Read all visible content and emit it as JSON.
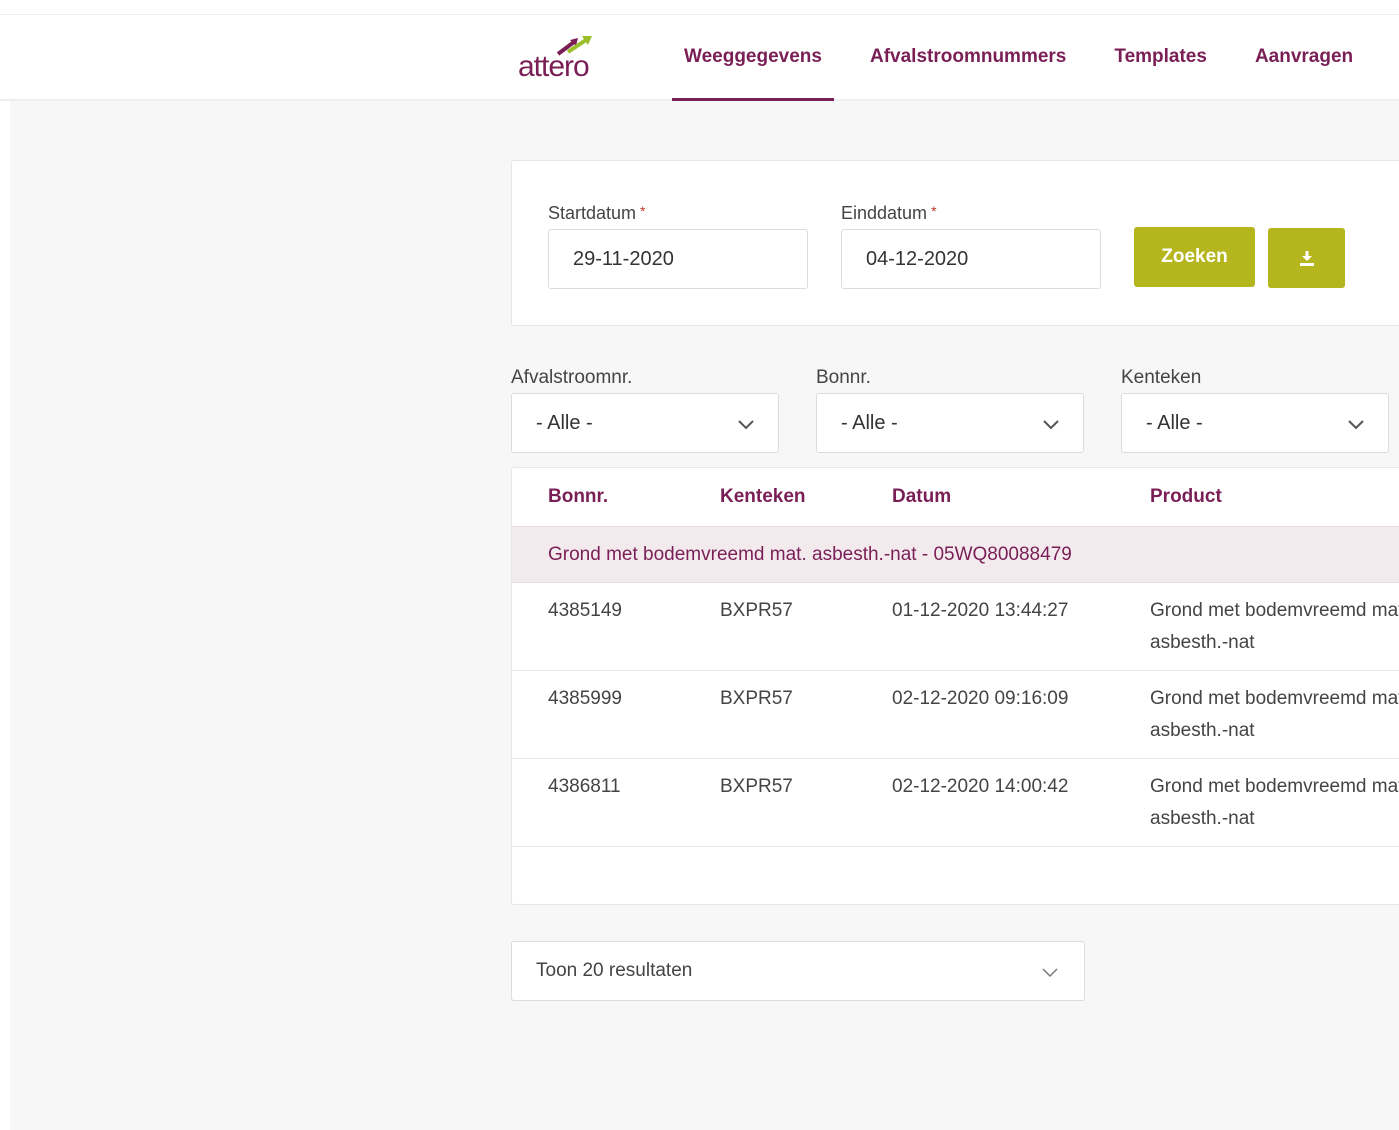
{
  "brand": {
    "logo_text": "attero",
    "accent_color": "#7a1f56",
    "button_color": "#b5b51e"
  },
  "nav": {
    "items": [
      {
        "label": "Weeggegevens",
        "active": true
      },
      {
        "label": "Afvalstroomnummers",
        "active": false
      },
      {
        "label": "Templates",
        "active": false
      },
      {
        "label": "Aanvragen",
        "active": false
      }
    ]
  },
  "dates": {
    "start_label": "Startdatum",
    "start_value": "29-11-2020",
    "end_label": "Einddatum",
    "end_value": "04-12-2020",
    "required_marker": "*",
    "search_button": "Zoeken",
    "download_icon": "download-icon"
  },
  "filters": {
    "afvalstroomnr": {
      "label": "Afvalstroomnr.",
      "value": "- Alle -"
    },
    "bonnr": {
      "label": "Bonnr.",
      "value": "- Alle -"
    },
    "kenteken": {
      "label": "Kenteken",
      "value": "- Alle -"
    }
  },
  "table": {
    "headers": {
      "bonnr": "Bonnr.",
      "kenteken": "Kenteken",
      "datum": "Datum",
      "product": "Product"
    },
    "group_label": "Grond met bodemvreemd mat. asbesth.-nat - 05WQ80088479",
    "rows": [
      {
        "bonnr": "4385149",
        "kenteken": "BXPR57",
        "datum": "01-12-2020 13:44:27",
        "product": "Grond met bodemvreemd mat. asbesth.-nat"
      },
      {
        "bonnr": "4385999",
        "kenteken": "BXPR57",
        "datum": "02-12-2020 09:16:09",
        "product": "Grond met bodemvreemd mat. asbesth.-nat"
      },
      {
        "bonnr": "4386811",
        "kenteken": "BXPR57",
        "datum": "02-12-2020 14:00:42",
        "product": "Grond met bodemvreemd mat. asbesth.-nat"
      }
    ]
  },
  "pager": {
    "label": "Toon 20 resultaten"
  }
}
